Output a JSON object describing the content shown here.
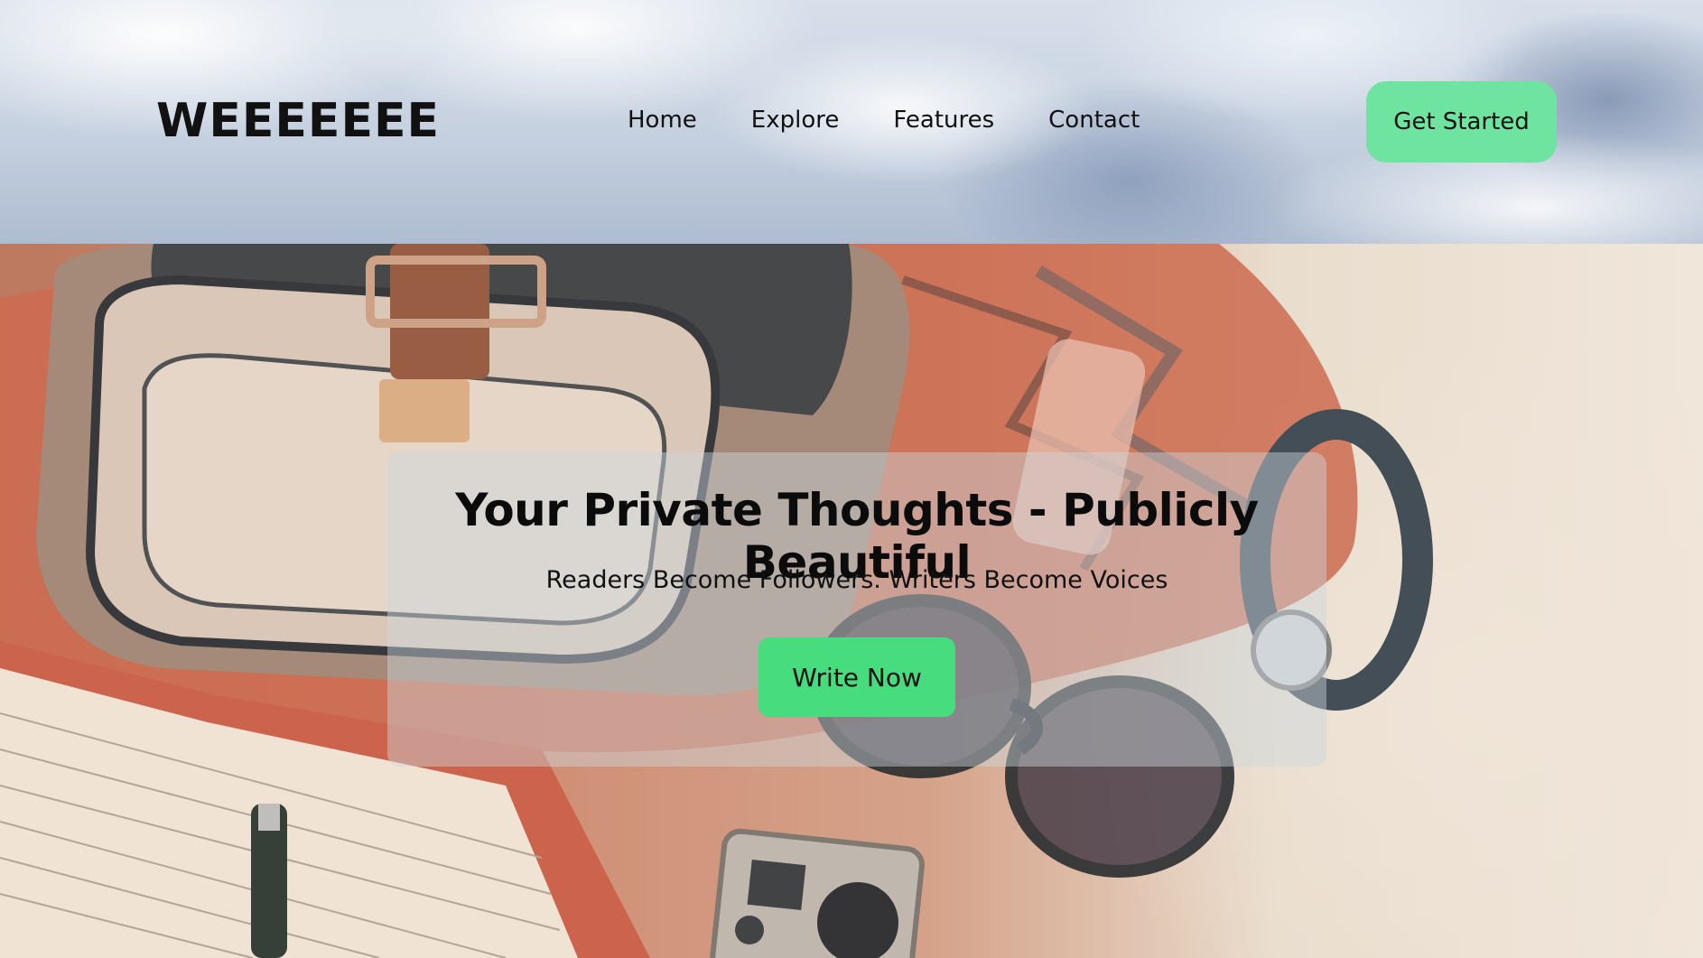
{
  "brand": {
    "logo_text": "WEEEEEEE"
  },
  "nav": {
    "items": [
      {
        "label": "Home"
      },
      {
        "label": "Explore"
      },
      {
        "label": "Features"
      },
      {
        "label": "Contact"
      }
    ]
  },
  "header": {
    "cta_label": "Get Started",
    "cta_color": "#6fe3a0"
  },
  "hero": {
    "title": "Your Private Thoughts - Publicly Beautiful",
    "subtitle": "Readers Become Followers. Writers Become Voices",
    "cta_label": "Write Now",
    "cta_color": "#47dc7d"
  }
}
